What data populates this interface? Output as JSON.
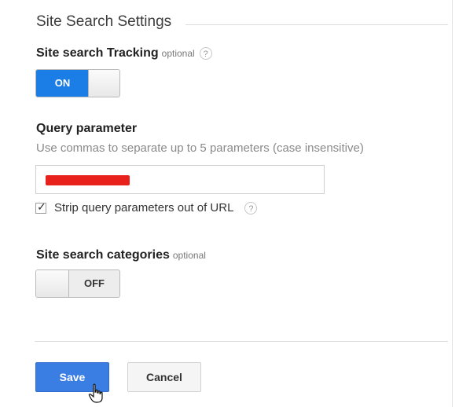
{
  "section": {
    "title": "Site Search Settings"
  },
  "tracking": {
    "label": "Site search Tracking",
    "optional": "optional",
    "help": "?",
    "toggle_state": "ON"
  },
  "query": {
    "label": "Query parameter",
    "hint": "Use commas to separate up to 5 parameters (case insensitive)",
    "input_value": "",
    "strip_label": "Strip query parameters out of URL",
    "strip_checked": true,
    "help": "?"
  },
  "categories": {
    "label": "Site search categories",
    "optional": "optional",
    "toggle_state": "OFF"
  },
  "actions": {
    "save_label": "Save",
    "cancel_label": "Cancel"
  },
  "colors": {
    "accent": "#1a7ee6",
    "save": "#3a7ee4",
    "redaction": "#e8211c"
  },
  "icons": {
    "help": "question-circle-icon",
    "check": "checkmark-icon",
    "cursor": "hand-pointer-icon"
  }
}
